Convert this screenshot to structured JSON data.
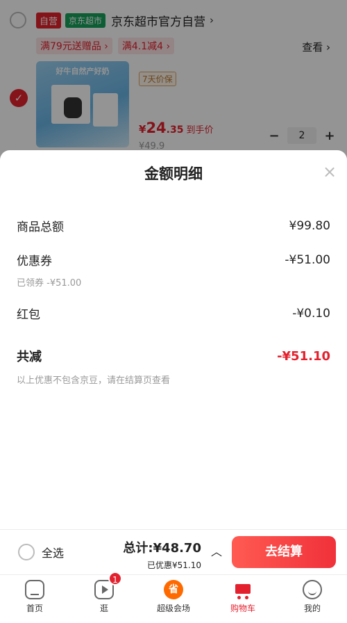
{
  "background": {
    "shop": {
      "tag_self": "自营",
      "tag_jd": "京东超市",
      "name": "京东超市官方自营",
      "chevron": "›"
    },
    "promos": [
      "满79元送赠品 ›",
      "满4.1减4 ›"
    ],
    "look_label": "查看 ›",
    "product": {
      "image_caption": "好牛自然产好奶",
      "guarantee": "7天价保",
      "price_yen": "¥",
      "price_int": "24",
      "price_dec": ".35",
      "price_note": "到手价",
      "orig_price": "¥49.9",
      "qty": "2",
      "minus": "−",
      "plus": "+"
    }
  },
  "sheet": {
    "title": "金额明细",
    "close_icon": "×",
    "rows": [
      {
        "label": "商品总额",
        "value": "¥99.80"
      },
      {
        "label": "优惠券",
        "value": "-¥51.00",
        "sub": "已领券 -¥51.00"
      },
      {
        "label": "红包",
        "value": "-¥0.10"
      }
    ],
    "total": {
      "label": "共减",
      "value": "-¥51.10",
      "note": "以上优惠不包含京豆，请在结算页查看"
    }
  },
  "bottom": {
    "select_all": "全选",
    "total": "总计:¥48.70",
    "saved": "已优惠¥51.10",
    "caret": "︿",
    "checkout": "去结算"
  },
  "tabs": [
    {
      "label": "首页",
      "icon": "home-icon"
    },
    {
      "label": "逛",
      "icon": "play-icon",
      "badge": "1"
    },
    {
      "label": "超级会场",
      "icon": "member-icon",
      "icon_text": "省"
    },
    {
      "label": "购物车",
      "icon": "cart-icon",
      "active": true
    },
    {
      "label": "我的",
      "icon": "face-icon"
    }
  ],
  "colors": {
    "accent": "#e3212e",
    "jd_green": "#18a35c"
  }
}
